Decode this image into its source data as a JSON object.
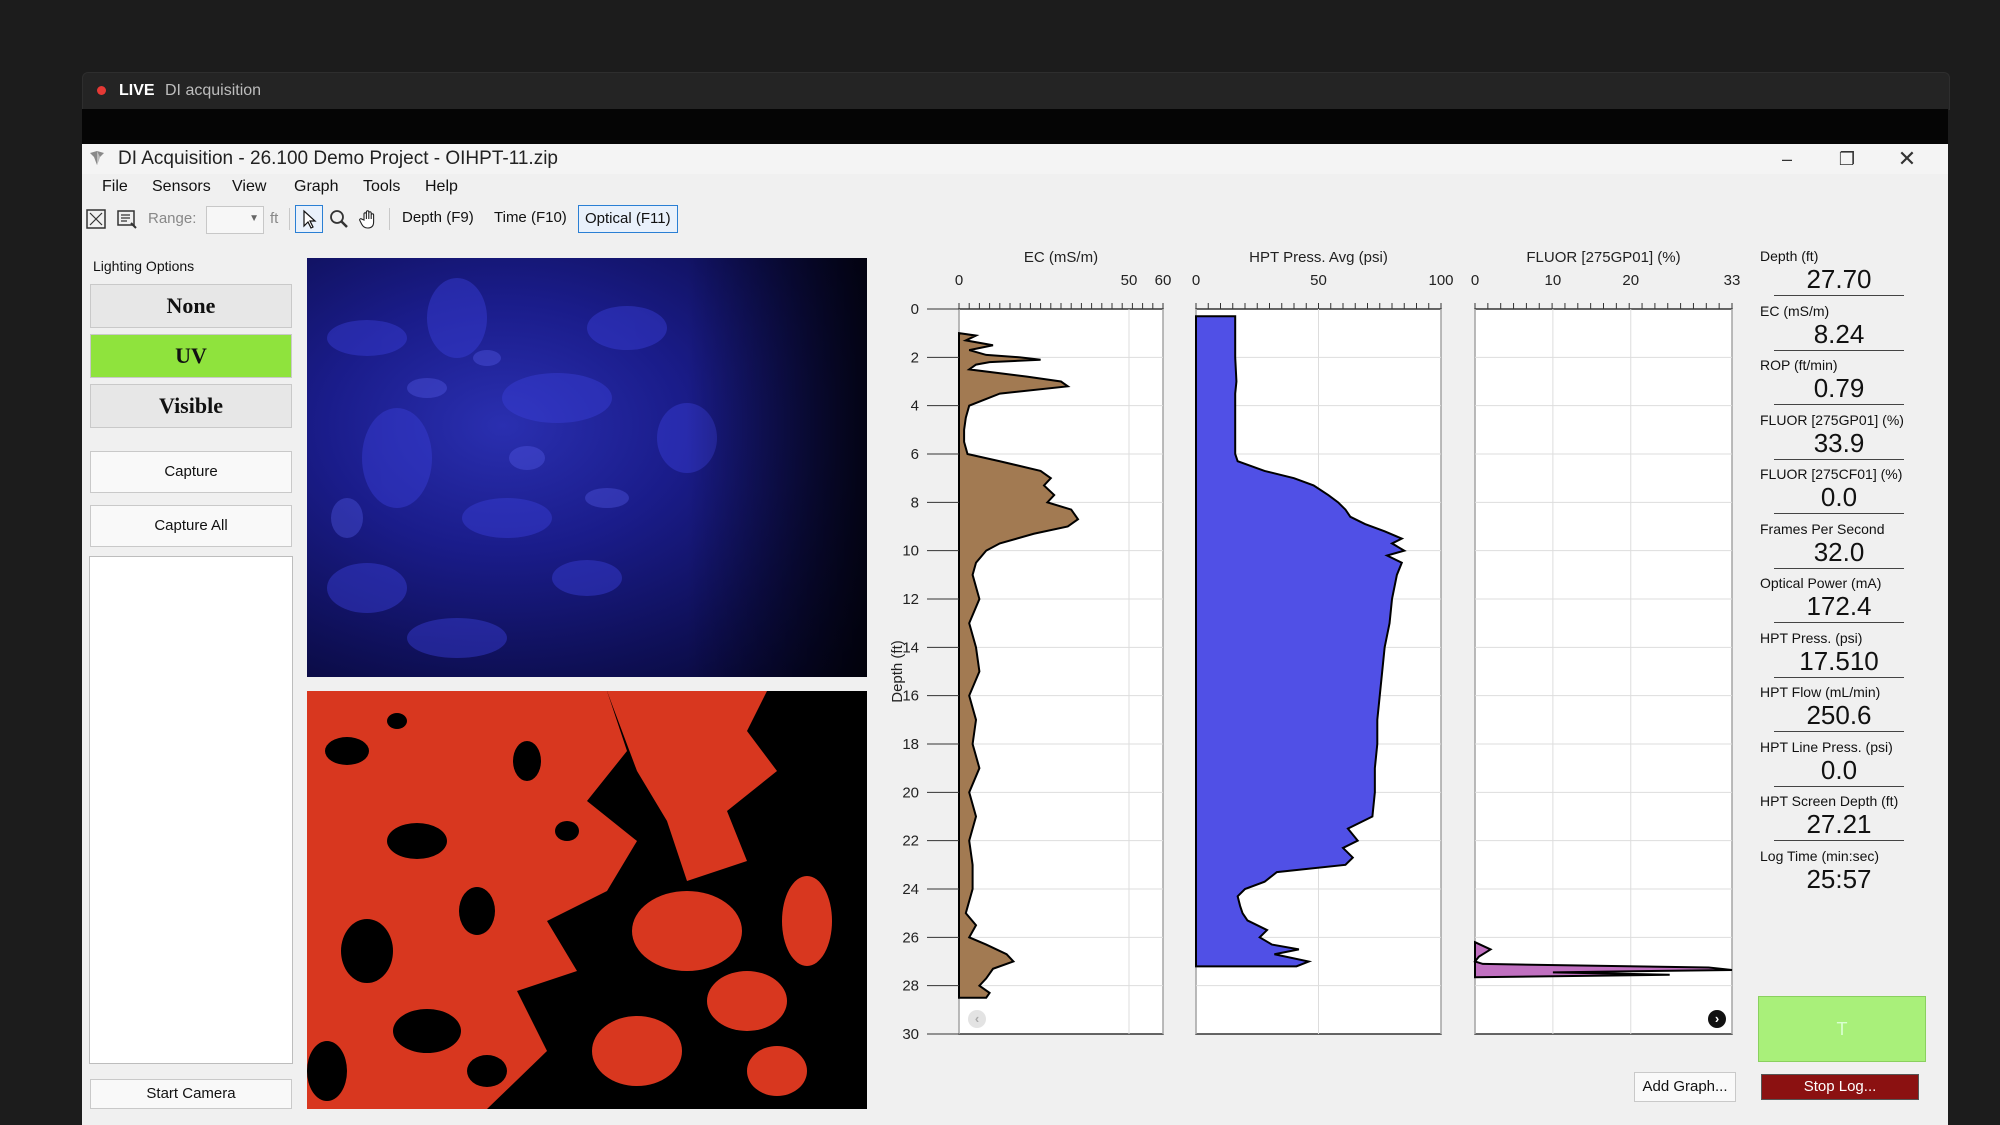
{
  "live_bar": {
    "status": "LIVE",
    "stream_title": "DI acquisition"
  },
  "window": {
    "title": "DI Acquisition - 26.100 Demo Project - OIHPT-11.zip",
    "min": "–",
    "restore": "❐",
    "close": "✕"
  },
  "menu": [
    "File",
    "Sensors",
    "View",
    "Graph",
    "Tools",
    "Help"
  ],
  "toolbar": {
    "range_label": "Range:",
    "range_value": "",
    "unit": "ft",
    "modes": [
      "Depth (F9)",
      "Time (F10)",
      "Optical (F11)"
    ],
    "active_mode": "Optical (F11)"
  },
  "left_panel": {
    "lighting_label": "Lighting Options",
    "lighting_options": [
      "None",
      "UV",
      "Visible"
    ],
    "active_lighting": "UV",
    "capture_label": "Capture",
    "capture_all_label": "Capture All",
    "start_camera_label": "Start Camera"
  },
  "colors": {
    "ec_fill": "#a27a52",
    "hpt_fill": "#5050e6",
    "fluor_fill": "#c070c0",
    "lighting_active": "#8fe33d",
    "stop_button": "#8b1111",
    "green_box": "#a9f07a",
    "orange_image": "#d8371f"
  },
  "chart_data": [
    {
      "type": "area",
      "title": "EC (mS/m)",
      "ylabel": "Depth (ft)",
      "xlim": [
        0,
        60
      ],
      "xticks": [
        "0",
        "50",
        "60"
      ],
      "ylim": [
        0,
        30
      ],
      "yticks": [
        "0",
        "2",
        "4",
        "6",
        "8",
        "10",
        "12",
        "14",
        "16",
        "18",
        "20",
        "22",
        "24",
        "26",
        "28",
        "30"
      ],
      "grid": true,
      "depth": [
        1.0,
        1.1,
        1.3,
        1.5,
        1.7,
        1.9,
        2.0,
        2.1,
        2.2,
        2.3,
        2.5,
        2.8,
        3.0,
        3.2,
        3.5,
        4.0,
        4.5,
        5.0,
        5.5,
        6.0,
        6.3,
        6.7,
        7.0,
        7.3,
        7.7,
        8.0,
        8.3,
        8.7,
        9.0,
        9.3,
        9.7,
        10.0,
        10.5,
        11.0,
        12.0,
        13.0,
        14.0,
        15.0,
        16.0,
        17.0,
        18.0,
        19.0,
        20.0,
        21.0,
        22.0,
        23.0,
        24.0,
        25.0,
        25.5,
        26.0,
        26.3,
        26.7,
        27.0,
        27.3,
        27.7,
        28.0,
        28.3,
        28.5
      ],
      "ec": [
        0,
        5,
        2,
        10,
        3,
        8,
        18,
        24,
        9,
        5,
        3,
        20,
        30,
        32,
        12,
        3,
        2,
        1.5,
        1.5,
        2.5,
        12,
        24,
        27,
        25,
        28,
        26,
        33,
        35,
        32,
        22,
        12,
        8,
        5,
        4,
        6,
        3,
        5,
        6,
        3,
        5,
        4,
        6,
        3,
        5,
        3,
        4,
        4,
        2,
        5,
        3,
        8,
        14,
        16,
        10,
        8,
        6,
        9,
        8
      ]
    },
    {
      "type": "area",
      "title": "HPT Press. Avg (psi)",
      "xlim": [
        0,
        100
      ],
      "xticks": [
        "0",
        "50",
        "100"
      ],
      "ylim": [
        0,
        30
      ],
      "grid": true,
      "depth": [
        0.3,
        2,
        3,
        3.5,
        4,
        5,
        6,
        6.3,
        6.7,
        7,
        7.3,
        7.7,
        8,
        8.3,
        8.6,
        8.9,
        9.2,
        9.5,
        9.7,
        10,
        10.2,
        10.5,
        11,
        12,
        13,
        14,
        15,
        16,
        17,
        18,
        19,
        20,
        21,
        21.5,
        22,
        22.3,
        22.7,
        23,
        23.3,
        23.7,
        24,
        24.3,
        24.7,
        25,
        25.3,
        25.7,
        26,
        26.3,
        26.5,
        26.7,
        27,
        27.2
      ],
      "psi": [
        16,
        16,
        16.5,
        16,
        16,
        16,
        16,
        17,
        28,
        40,
        48,
        54,
        58,
        61,
        63,
        69,
        77,
        84,
        80,
        85,
        78,
        84,
        82,
        80,
        79,
        77,
        76,
        75,
        74,
        74,
        73,
        73,
        72,
        62,
        66,
        60,
        64,
        61,
        33,
        28,
        20,
        17,
        18,
        19,
        21,
        29,
        26,
        31,
        42,
        32,
        46,
        41
      ]
    },
    {
      "type": "area",
      "title": "FLUOR [275GP01] (%)",
      "xlim": [
        0,
        33
      ],
      "xticks": [
        "0",
        "10",
        "20",
        "33"
      ],
      "ylim": [
        0,
        30
      ],
      "grid": true,
      "depth": [
        26.2,
        26.5,
        26.8,
        27.0,
        27.1,
        27.25,
        27.35,
        27.45,
        27.55,
        27.65
      ],
      "fluor": [
        0,
        2,
        0.5,
        0,
        1,
        30,
        33,
        10,
        25,
        0
      ]
    }
  ],
  "readouts": [
    {
      "label": "Depth (ft)",
      "value": "27.70"
    },
    {
      "label": "EC (mS/m)",
      "value": "8.24"
    },
    {
      "label": "ROP (ft/min)",
      "value": "0.79"
    },
    {
      "label": "FLUOR [275GP01] (%)",
      "value": "33.9"
    },
    {
      "label": "FLUOR [275CF01] (%)",
      "value": "0.0"
    },
    {
      "label": "Frames Per Second",
      "value": "32.0"
    },
    {
      "label": "Optical Power (mA)",
      "value": "172.4"
    },
    {
      "label": "HPT Press. (psi)",
      "value": "17.510"
    },
    {
      "label": "HPT Flow (mL/min)",
      "value": "250.6"
    },
    {
      "label": "HPT Line Press. (psi)",
      "value": "0.0"
    },
    {
      "label": "HPT Screen Depth (ft)",
      "value": "27.21"
    },
    {
      "label": "Log Time (min:sec)",
      "value": "25:57"
    }
  ],
  "bottom_buttons": {
    "add_graph": "Add Graph...",
    "stop_log": "Stop Log...",
    "indicator": "T"
  }
}
